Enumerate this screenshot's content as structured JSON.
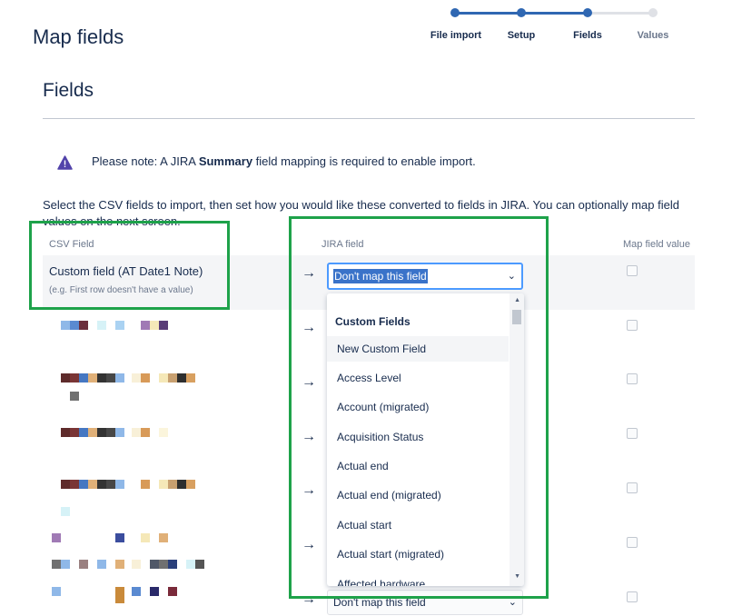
{
  "page": {
    "title": "Map fields"
  },
  "progress": {
    "steps": [
      {
        "label": "File import",
        "done": true
      },
      {
        "label": "Setup",
        "done": true
      },
      {
        "label": "Fields",
        "done": true
      },
      {
        "label": "Values",
        "done": false
      }
    ]
  },
  "section": {
    "title": "Fields"
  },
  "notice": {
    "before": "Please note: A JIRA ",
    "bold": "Summary",
    "after": " field mapping is required to enable import."
  },
  "intro": "Select the CSV fields to import, then set how you would like these converted to fields in JIRA. You can optionally map field values on the next screen.",
  "columns": {
    "csv": "CSV Field",
    "jira": "JIRA field",
    "map_value": "Map field value"
  },
  "first_row": {
    "csv_name": "Custom field (AT Date1 Note)",
    "csv_hint": "(e.g. First row doesn't have a value)",
    "jira_value": "Don't map this field"
  },
  "last_row": {
    "jira_value": "Don't map this field"
  },
  "arrow_glyph": "→",
  "chevron_glyph": "⌄",
  "dropdown": {
    "group": "Custom Fields",
    "items": [
      "New Custom Field",
      "Access Level",
      "Account (migrated)",
      "Acquisition Status",
      "Actual end",
      "Actual end (migrated)",
      "Actual start",
      "Actual start (migrated)",
      "Affected hardware"
    ],
    "hovered_index": 0
  },
  "colors": {
    "accent": "#2f67b2",
    "highlight": "#1ea24a",
    "focus": "#4c9aff"
  }
}
